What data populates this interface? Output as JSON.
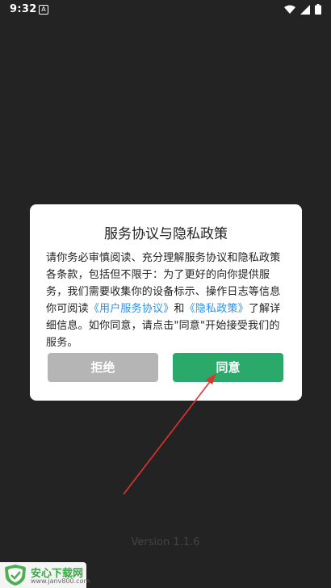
{
  "status_bar": {
    "time": "9:32",
    "notification_glyph": "A",
    "icons": [
      "wifi-icon",
      "signal-icon",
      "battery-icon"
    ]
  },
  "dialog": {
    "title": "服务协议与隐私政策",
    "body_part1": "请你务必审慎阅读、充分理解服务协议和隐私政策各条款，包括但不限于：为了更好的向你提供服务，我们需要收集你的设备标示、操作日志等信息你可阅读",
    "link_user_agreement": "《用户服务协议》",
    "body_and": "和",
    "link_privacy_policy": "《隐私政策》",
    "body_part2": "了解详细信息。如你同意，请点击\"同意\"开始接受我们的服务。",
    "reject_label": "拒绝",
    "agree_label": "同意"
  },
  "footer": {
    "version": "Version 1.1.6"
  },
  "watermark": {
    "title": "安心下载网",
    "url": "www.janv800.com"
  },
  "colors": {
    "background": "#232323",
    "agree_button": "#2aa96a",
    "reject_button": "#b5b5b5",
    "link": "#2f8ee8",
    "annotation_arrow": "#e0342e"
  }
}
